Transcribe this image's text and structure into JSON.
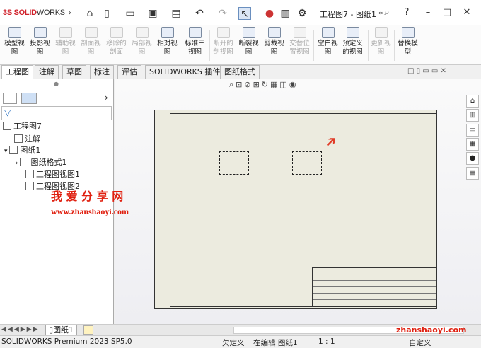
{
  "app": {
    "logo_ds": "3S",
    "logo_solid": "SOLID",
    "logo_works": "WORKS",
    "title": "工程图7 - 图纸1 *",
    "expand_arrow": "›"
  },
  "ribbon": {
    "buttons": [
      {
        "label": "模型视\n图",
        "enabled": true
      },
      {
        "label": "投影视\n图",
        "enabled": true
      },
      {
        "label": "辅助视\n图",
        "enabled": false
      },
      {
        "label": "剖面视\n图",
        "enabled": false
      },
      {
        "label": "移除的\n剖面",
        "enabled": false
      },
      {
        "label": "局部视\n图",
        "enabled": false
      },
      {
        "label": "相对视\n图",
        "enabled": true
      },
      {
        "label": "标准三\n视图",
        "enabled": true
      },
      {
        "label": "断开的\n剖视图",
        "enabled": false
      },
      {
        "label": "断裂视\n图",
        "enabled": true
      },
      {
        "label": "剪裁视\n图",
        "enabled": true
      },
      {
        "label": "交替位\n置视图",
        "enabled": false
      },
      {
        "label": "空白视\n图",
        "enabled": true
      },
      {
        "label": "预定义\n的视图",
        "enabled": true
      },
      {
        "label": "更新视\n图",
        "enabled": false
      },
      {
        "label": "替换模\n型",
        "enabled": true
      }
    ]
  },
  "tabs": [
    "工程图",
    "注解",
    "草图",
    "标注",
    "评估",
    "SOLIDWORKS 插件",
    "图纸格式"
  ],
  "tree": {
    "root": "工程图7",
    "items": [
      "注解",
      "图纸1",
      "图纸格式1",
      "工程图视图1",
      "工程图视图2"
    ]
  },
  "watermark": {
    "title": "我 爱 分 享 网",
    "url": "www.zhanshaoyi.com",
    "corner": "zhanshaoyi.com"
  },
  "sheet_tabs": [
    "图纸1"
  ],
  "status": {
    "product": "SOLIDWORKS Premium 2023 SP5.0",
    "state": "欠定义",
    "editing": "在编辑 图纸1",
    "scale": "1 : 1",
    "custom": "自定义"
  },
  "colors": {
    "accent": "#d0202a",
    "sheet": "#ecebdf"
  }
}
